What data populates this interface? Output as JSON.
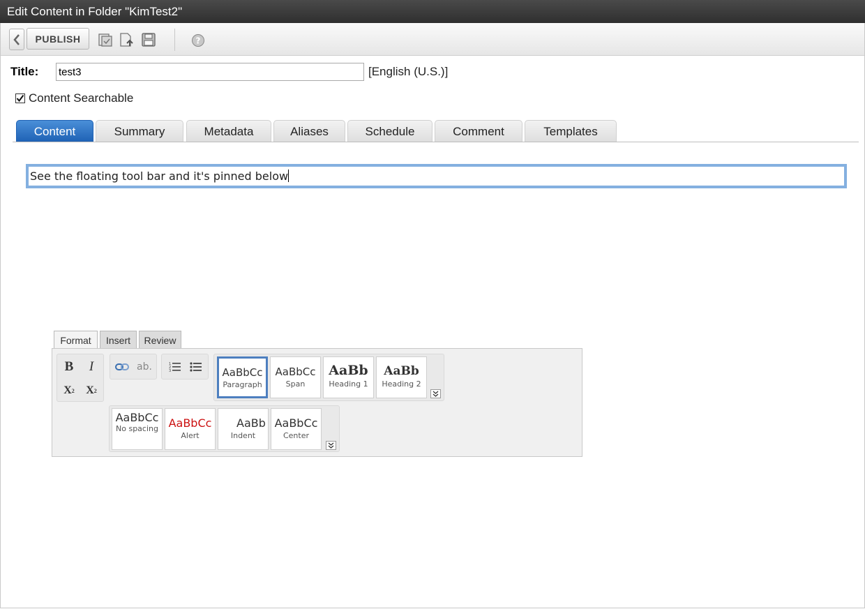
{
  "window": {
    "title": "Edit Content in Folder \"KimTest2\""
  },
  "toolbar": {
    "publish_label": "PUBLISH",
    "icons": [
      "back-chevron-icon",
      "checkin-icon",
      "upload-icon",
      "save-icon",
      "help-icon"
    ]
  },
  "form": {
    "title_label": "Title:",
    "title_value": "test3",
    "language": "[English (U.S.)]",
    "searchable_label": "Content Searchable",
    "searchable_checked": true
  },
  "tabs": [
    "Content",
    "Summary",
    "Metadata",
    "Aliases",
    "Schedule",
    "Comment",
    "Templates"
  ],
  "active_tab": "Content",
  "editor": {
    "text": "See the floating tool bar and it's pinned below"
  },
  "ribbon": {
    "tabs": [
      "Format",
      "Insert",
      "Review"
    ],
    "active_tab": "Format",
    "format_buttons": {
      "bold": "B",
      "italic": "I",
      "subscript": "X",
      "superscript": "X",
      "remove_format": "ab."
    },
    "styles_row1": [
      {
        "sample": "AaBbCc",
        "name": "Paragraph"
      },
      {
        "sample": "AaBbCc",
        "name": "Span"
      },
      {
        "sample": "AaBb",
        "name": "Heading 1"
      },
      {
        "sample": "AaBb",
        "name": "Heading 2"
      }
    ],
    "styles_row2": [
      {
        "sample": "AaBbCc",
        "name": "No spacing"
      },
      {
        "sample": "AaBbCc",
        "name": "Alert"
      },
      {
        "sample": "AaBb",
        "name": "Indent"
      },
      {
        "sample": "AaBbCc",
        "name": "Center"
      }
    ],
    "colors": {
      "selected_border": "#4d7fbf",
      "alert_text": "#cc1111",
      "active_tab": "#1f62b5"
    }
  }
}
